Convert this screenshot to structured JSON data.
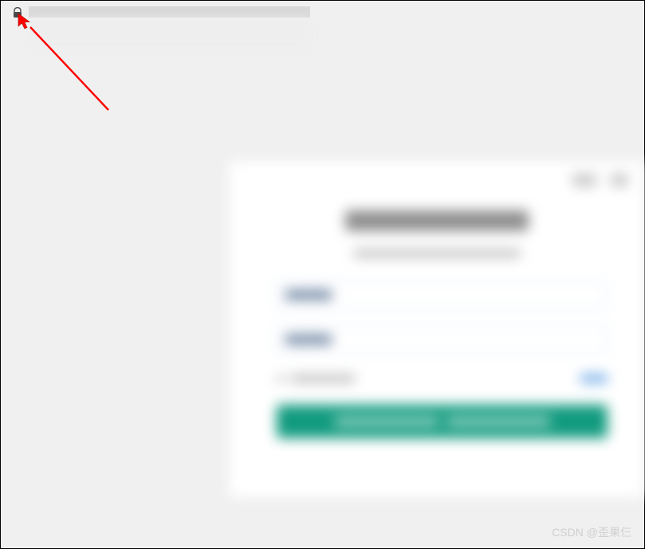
{
  "watermark": "CSDN @歪果仨"
}
